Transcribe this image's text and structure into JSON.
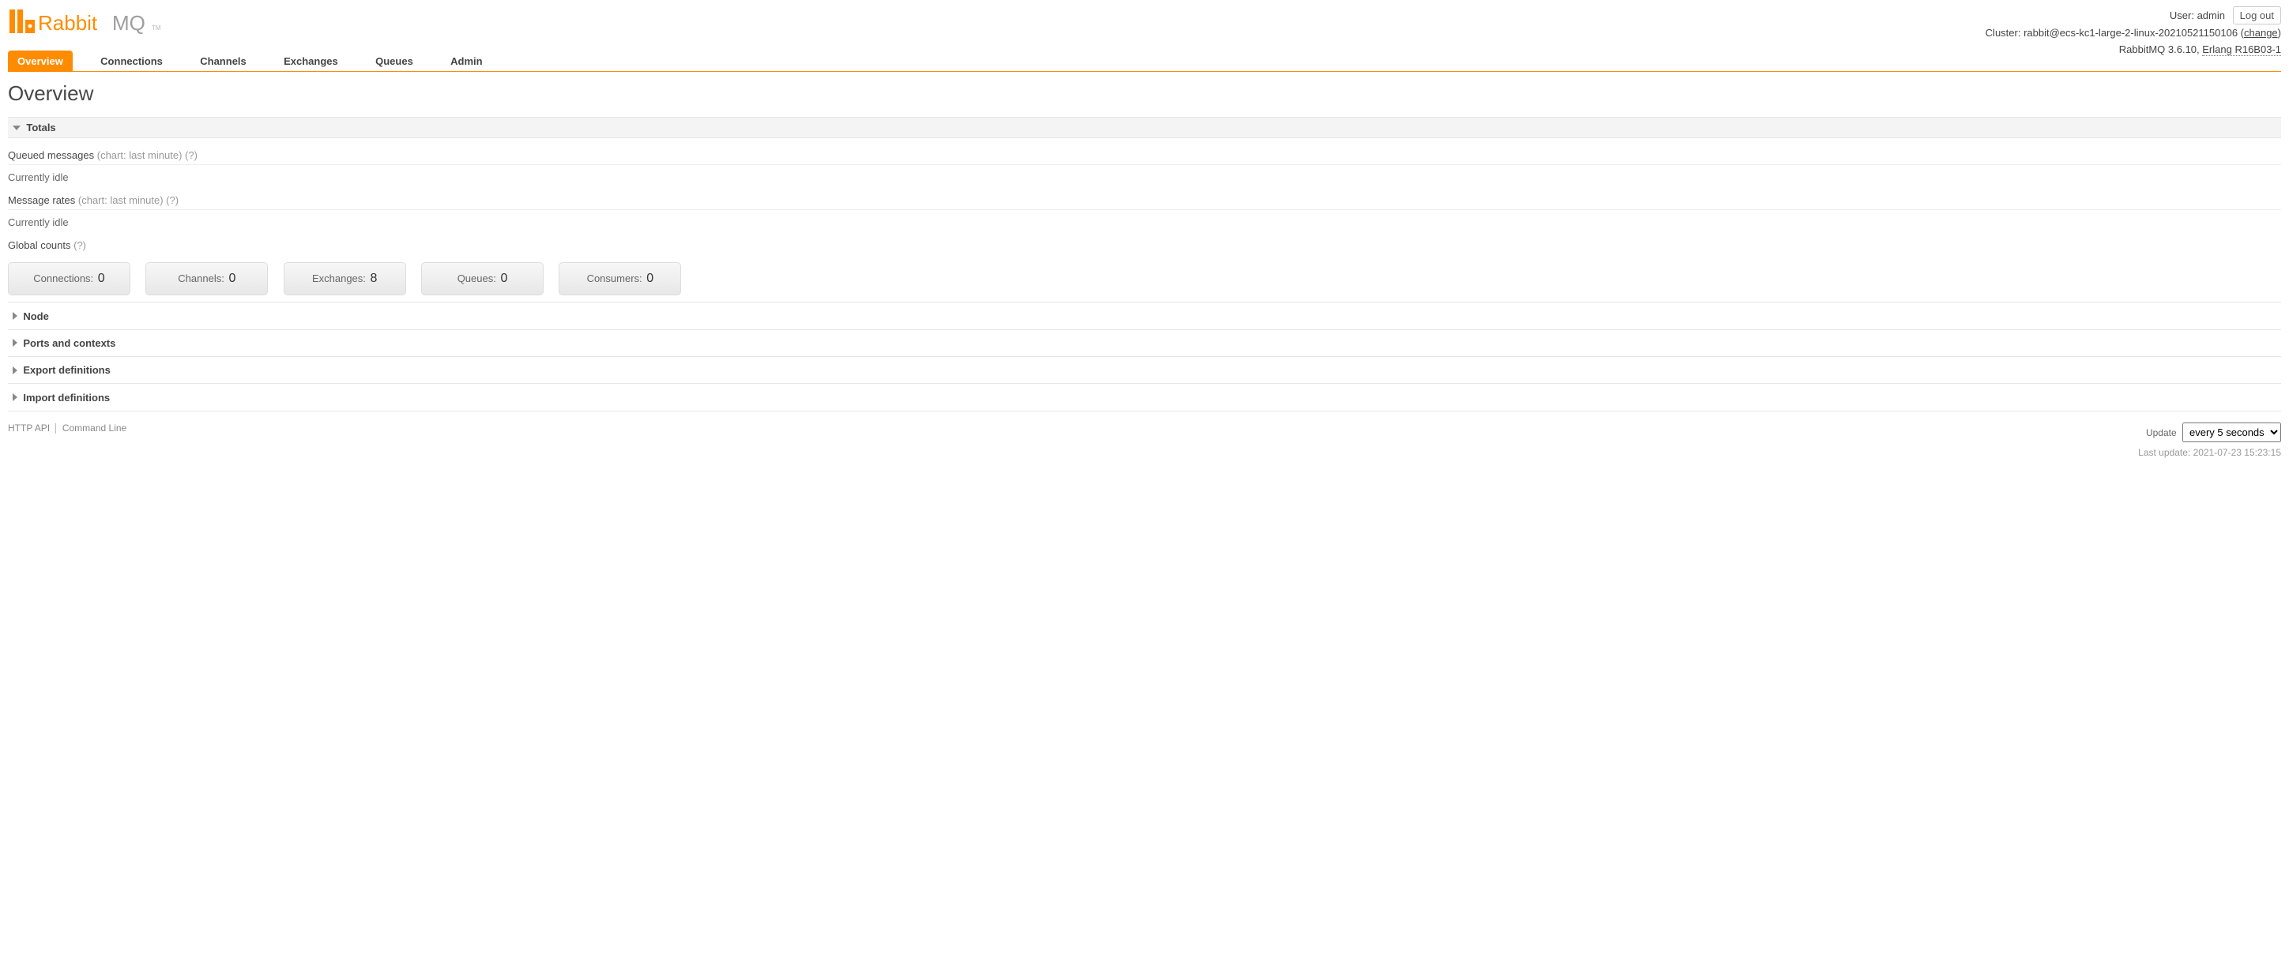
{
  "header": {
    "user_label": "User:",
    "user": "admin",
    "logout": "Log out",
    "cluster_label": "Cluster:",
    "cluster": "rabbit@ecs-kc1-large-2-linux-20210521150106",
    "change": "change",
    "version_rabbit": "RabbitMQ 3.6.10,",
    "version_erlang": "Erlang R16B03-1"
  },
  "tabs": [
    {
      "label": "Overview",
      "selected": true
    },
    {
      "label": "Connections",
      "selected": false
    },
    {
      "label": "Channels",
      "selected": false
    },
    {
      "label": "Exchanges",
      "selected": false
    },
    {
      "label": "Queues",
      "selected": false
    },
    {
      "label": "Admin",
      "selected": false
    }
  ],
  "page_title": "Overview",
  "totals": {
    "header": "Totals",
    "queued_label": "Queued messages",
    "queued_hint": "(chart: last minute)",
    "queued_status": "Currently idle",
    "rates_label": "Message rates",
    "rates_hint": "(chart: last minute)",
    "rates_status": "Currently idle",
    "global_label": "Global counts",
    "help": "(?)",
    "counts": [
      {
        "label": "Connections:",
        "value": "0"
      },
      {
        "label": "Channels:",
        "value": "0"
      },
      {
        "label": "Exchanges:",
        "value": "8"
      },
      {
        "label": "Queues:",
        "value": "0"
      },
      {
        "label": "Consumers:",
        "value": "0"
      }
    ]
  },
  "collapsed_sections": [
    "Node",
    "Ports and contexts",
    "Export definitions",
    "Import definitions"
  ],
  "footer": {
    "http_api": "HTTP API",
    "cli": "Command Line",
    "update_label": "Update",
    "update_selected": "every 5 seconds",
    "last_update_label": "Last update:",
    "last_update_time": "2021-07-23 15:23:15"
  }
}
